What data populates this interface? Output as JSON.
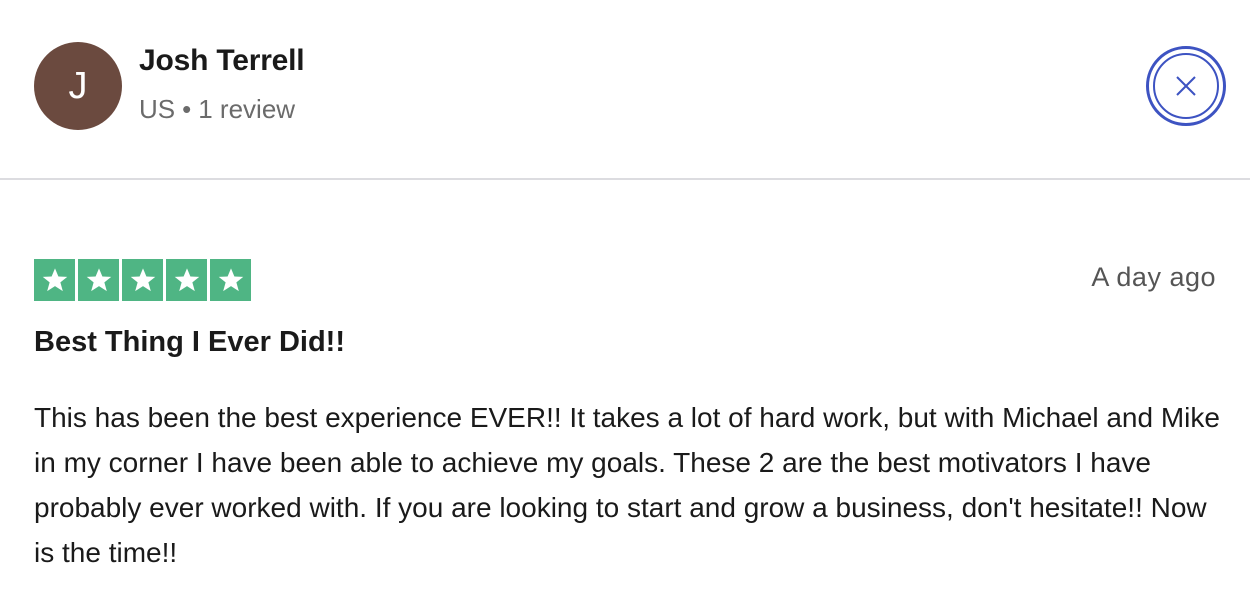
{
  "reviewer": {
    "initial": "J",
    "name": "Josh Terrell",
    "country": "US",
    "separator": "•",
    "review_count": "1 review",
    "avatar_color": "#6b4a3f"
  },
  "close_button": {
    "icon": "close-icon",
    "color": "#3d53c2"
  },
  "review": {
    "rating": 5,
    "max_rating": 5,
    "star_color": "#4fb584",
    "date": "A day ago",
    "title": "Best Thing I Ever Did!!",
    "body": "This has been the best experience EVER!! It takes a lot of hard work, but with Michael and Mike in my corner I have been able to achieve my goals. These 2 are the best motivators I have probably ever worked with. If you are looking to start and grow a business, don't hesitate!! Now is the time!!"
  }
}
